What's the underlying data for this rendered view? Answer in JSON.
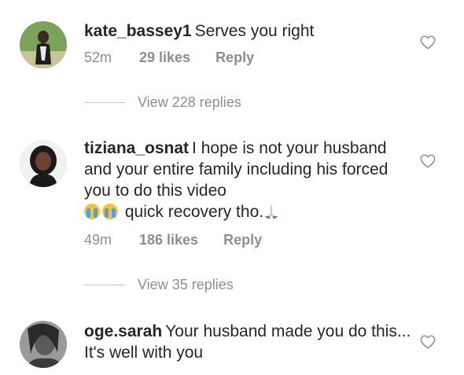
{
  "comments": [
    {
      "username": "kate_bassey1",
      "text": "Serves you right",
      "time": "52m",
      "likes": "29 likes",
      "reply": "Reply",
      "view_replies": "View 228 replies",
      "avatar_icon": "avatar-photo"
    },
    {
      "username": "tiziana_osnat",
      "text": "I hope is not your husband and your entire family including his forced you to do this video",
      "text_end": "quick recovery tho.",
      "emojis": [
        "loudly-crying-face",
        "loudly-crying-face",
        "folded-hands"
      ],
      "time": "49m",
      "likes": "186 likes",
      "reply": "Reply",
      "view_replies": "View 35 replies",
      "avatar_icon": "avatar-photo"
    },
    {
      "username": "oge.sarah",
      "text": "Your husband made you do this... It's well with you",
      "avatar_icon": "avatar-photo"
    }
  ],
  "icons": {
    "like": "heart-outline-icon"
  },
  "colors": {
    "text": "#262626",
    "secondary": "#8e8e8e",
    "divider": "#c7c7c7"
  }
}
